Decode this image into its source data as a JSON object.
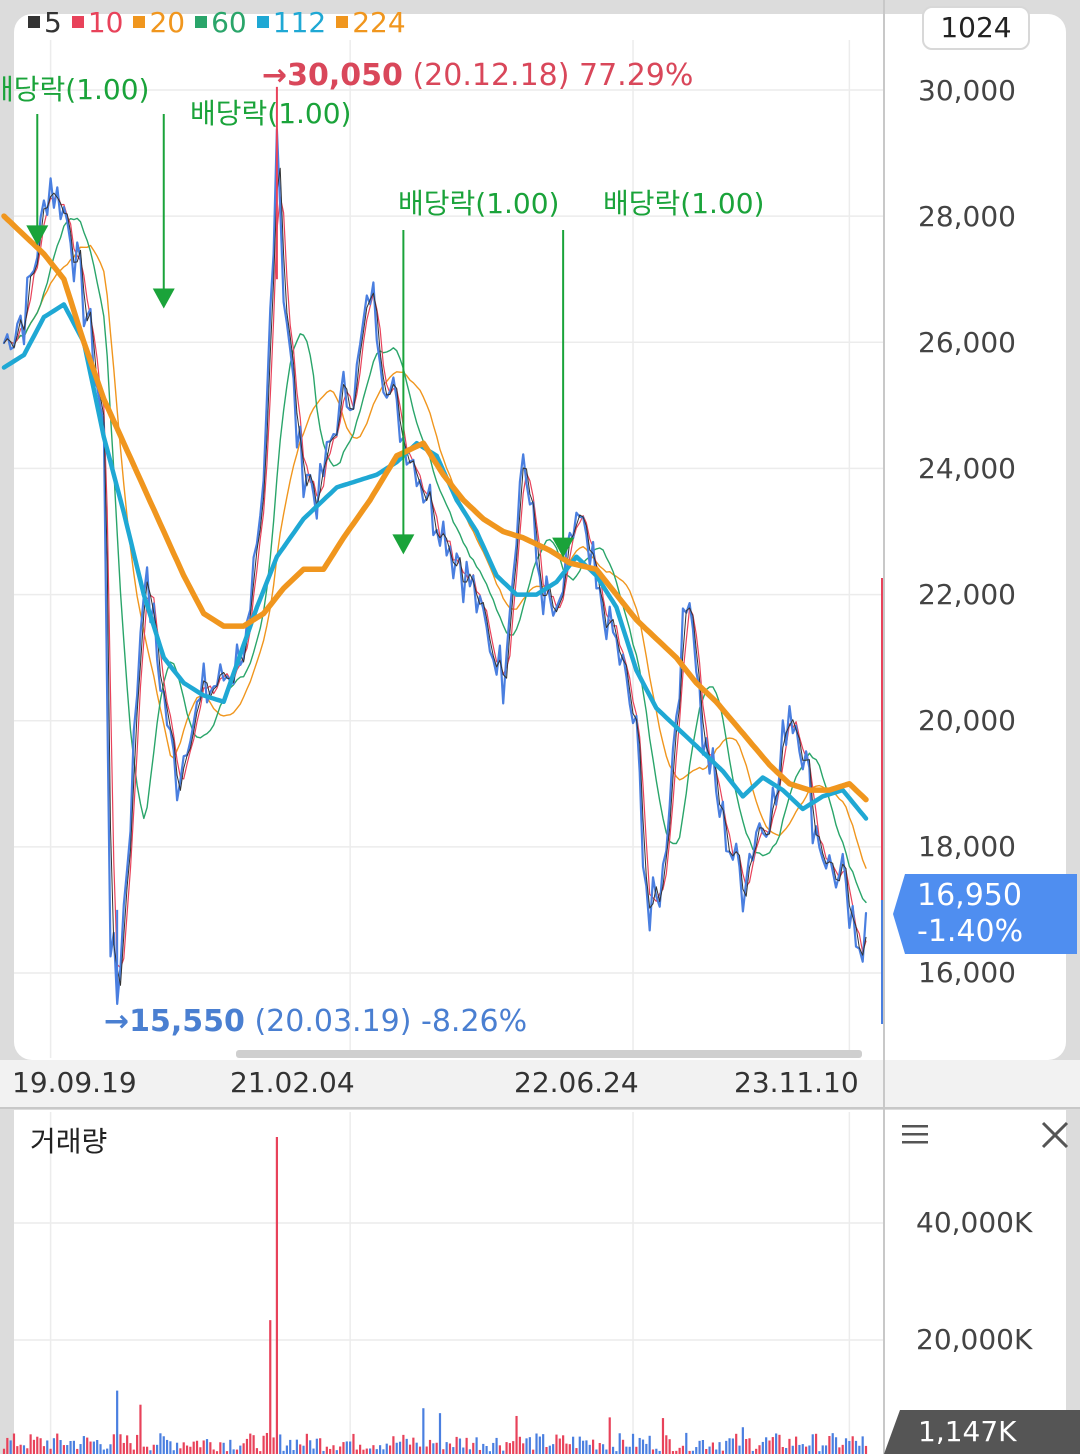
{
  "legend": [
    {
      "label": "5",
      "color": "#333333"
    },
    {
      "label": "10",
      "color": "#e8425a"
    },
    {
      "label": "20",
      "color": "#f0961e"
    },
    {
      "label": "60",
      "color": "#2aa56a"
    },
    {
      "label": "112",
      "color": "#1fa8d4"
    },
    {
      "label": "224",
      "color": "#f0961e"
    }
  ],
  "period": "1024",
  "high": {
    "arrow": "→",
    "value": "30,050",
    "detail": "(20.12.18) 77.29%"
  },
  "low": {
    "arrow": "→",
    "value": "15,550",
    "detail": "(20.03.19) -8.26%"
  },
  "dividend_label": "배당락(1.00)",
  "current": {
    "value": "16,950",
    "change": "-1.40%"
  },
  "volume": {
    "title": "거래량",
    "current": "1,147K",
    "ticks": [
      "40,000K",
      "20,000K"
    ]
  },
  "colors": {
    "up": "#e8425a",
    "down": "#4a7fe0",
    "accent": "#4f8ef0",
    "dividend": "#1aa33a"
  },
  "icons": {
    "menu": "hamburger-icon",
    "close": "close-icon"
  },
  "chart_data": {
    "type": "line",
    "title": "",
    "ylim": [
      14500,
      31000
    ],
    "yticks": [
      "30,000",
      "28,000",
      "26,000",
      "24,000",
      "22,000",
      "20,000",
      "18,000",
      "16,000"
    ],
    "ytick_values": [
      30000,
      28000,
      26000,
      24000,
      22000,
      20000,
      18000,
      16000
    ],
    "xticks": [
      "19.09.19",
      "21.02.04",
      "22.06.24",
      "23.11.10"
    ],
    "x_tick_index": [
      14,
      104,
      189,
      254
    ],
    "x_count": 260,
    "price_anchors": [
      [
        0,
        26000
      ],
      [
        6,
        26500
      ],
      [
        10,
        27500
      ],
      [
        14,
        28600
      ],
      [
        20,
        27800
      ],
      [
        26,
        26200
      ],
      [
        30,
        24500
      ],
      [
        32,
        16500
      ],
      [
        34,
        15550
      ],
      [
        38,
        18500
      ],
      [
        42,
        22500
      ],
      [
        46,
        21000
      ],
      [
        52,
        19000
      ],
      [
        56,
        20000
      ],
      [
        62,
        20500
      ],
      [
        68,
        20800
      ],
      [
        74,
        21500
      ],
      [
        78,
        23500
      ],
      [
        82,
        29500
      ],
      [
        84,
        27000
      ],
      [
        88,
        24500
      ],
      [
        94,
        23500
      ],
      [
        100,
        24800
      ],
      [
        106,
        25500
      ],
      [
        110,
        26800
      ],
      [
        116,
        25200
      ],
      [
        120,
        24500
      ],
      [
        126,
        23800
      ],
      [
        132,
        23000
      ],
      [
        138,
        22500
      ],
      [
        144,
        21500
      ],
      [
        150,
        20800
      ],
      [
        156,
        24300
      ],
      [
        160,
        22500
      ],
      [
        166,
        21500
      ],
      [
        172,
        23300
      ],
      [
        178,
        22000
      ],
      [
        184,
        21200
      ],
      [
        190,
        19800
      ],
      [
        194,
        16700
      ],
      [
        198,
        17500
      ],
      [
        202,
        20200
      ],
      [
        206,
        22200
      ],
      [
        210,
        19800
      ],
      [
        216,
        18300
      ],
      [
        222,
        17500
      ],
      [
        226,
        18300
      ],
      [
        232,
        18700
      ],
      [
        236,
        20300
      ],
      [
        240,
        19700
      ],
      [
        244,
        18300
      ],
      [
        248,
        17700
      ],
      [
        252,
        17400
      ],
      [
        256,
        16200
      ],
      [
        259,
        16950
      ]
    ],
    "series": [
      {
        "label": "5",
        "color": "#333333",
        "width": 1.2
      },
      {
        "label": "10",
        "color": "#e8425a",
        "width": 1.2
      },
      {
        "label": "20",
        "color": "#f0961e",
        "width": 1.4
      },
      {
        "label": "60",
        "color": "#2aa56a",
        "width": 1.4
      },
      {
        "label": "112",
        "color": "#1fa8d4",
        "width": 4.5
      },
      {
        "label": "224",
        "color": "#f0961e",
        "width": 5.5
      }
    ],
    "ma112_anchors": [
      [
        0,
        25600
      ],
      [
        6,
        25800
      ],
      [
        12,
        26400
      ],
      [
        18,
        26600
      ],
      [
        24,
        26000
      ],
      [
        30,
        24500
      ],
      [
        36,
        23300
      ],
      [
        42,
        22000
      ],
      [
        48,
        21000
      ],
      [
        54,
        20600
      ],
      [
        60,
        20400
      ],
      [
        66,
        20300
      ],
      [
        70,
        20900
      ],
      [
        76,
        21800
      ],
      [
        82,
        22600
      ],
      [
        90,
        23200
      ],
      [
        100,
        23700
      ],
      [
        106,
        23800
      ],
      [
        112,
        23900
      ],
      [
        118,
        24100
      ],
      [
        124,
        24400
      ],
      [
        130,
        24200
      ],
      [
        136,
        23500
      ],
      [
        142,
        23000
      ],
      [
        148,
        22300
      ],
      [
        154,
        22000
      ],
      [
        160,
        22000
      ],
      [
        166,
        22200
      ],
      [
        172,
        22600
      ],
      [
        178,
        22300
      ],
      [
        184,
        21800
      ],
      [
        190,
        20800
      ],
      [
        196,
        20200
      ],
      [
        204,
        19800
      ],
      [
        210,
        19500
      ],
      [
        216,
        19200
      ],
      [
        222,
        18800
      ],
      [
        228,
        19100
      ],
      [
        234,
        18900
      ],
      [
        240,
        18600
      ],
      [
        246,
        18800
      ],
      [
        252,
        18900
      ],
      [
        259,
        18450
      ]
    ],
    "ma224_anchors": [
      [
        0,
        28000
      ],
      [
        6,
        27700
      ],
      [
        12,
        27400
      ],
      [
        18,
        27000
      ],
      [
        24,
        26000
      ],
      [
        30,
        25100
      ],
      [
        36,
        24400
      ],
      [
        42,
        23700
      ],
      [
        48,
        23000
      ],
      [
        54,
        22300
      ],
      [
        60,
        21700
      ],
      [
        66,
        21500
      ],
      [
        72,
        21500
      ],
      [
        78,
        21700
      ],
      [
        84,
        22100
      ],
      [
        90,
        22400
      ],
      [
        96,
        22400
      ],
      [
        102,
        22900
      ],
      [
        110,
        23500
      ],
      [
        118,
        24200
      ],
      [
        126,
        24400
      ],
      [
        132,
        23900
      ],
      [
        138,
        23500
      ],
      [
        144,
        23200
      ],
      [
        150,
        23000
      ],
      [
        156,
        22900
      ],
      [
        164,
        22700
      ],
      [
        170,
        22500
      ],
      [
        178,
        22400
      ],
      [
        184,
        22000
      ],
      [
        190,
        21600
      ],
      [
        196,
        21300
      ],
      [
        202,
        21000
      ],
      [
        208,
        20600
      ],
      [
        214,
        20300
      ],
      [
        222,
        19800
      ],
      [
        230,
        19300
      ],
      [
        236,
        19000
      ],
      [
        242,
        18900
      ],
      [
        248,
        18900
      ],
      [
        254,
        19000
      ],
      [
        259,
        18750
      ]
    ],
    "dividend_markers": [
      {
        "x": 10,
        "price": 27600
      },
      {
        "x": 48,
        "price": 26600
      },
      {
        "x": 120,
        "price": 22700
      },
      {
        "x": 168,
        "price": 22650
      }
    ],
    "volume": {
      "ylim": [
        0,
        46000
      ],
      "spikes": [
        [
          82,
          45000
        ],
        [
          80,
          19000
        ],
        [
          34,
          9000
        ],
        [
          41,
          7000
        ],
        [
          126,
          6500
        ],
        [
          131,
          5800
        ],
        [
          182,
          5200
        ],
        [
          154,
          5400
        ],
        [
          198,
          5100
        ],
        [
          222,
          3800
        ],
        [
          259,
          1147
        ]
      ]
    }
  }
}
